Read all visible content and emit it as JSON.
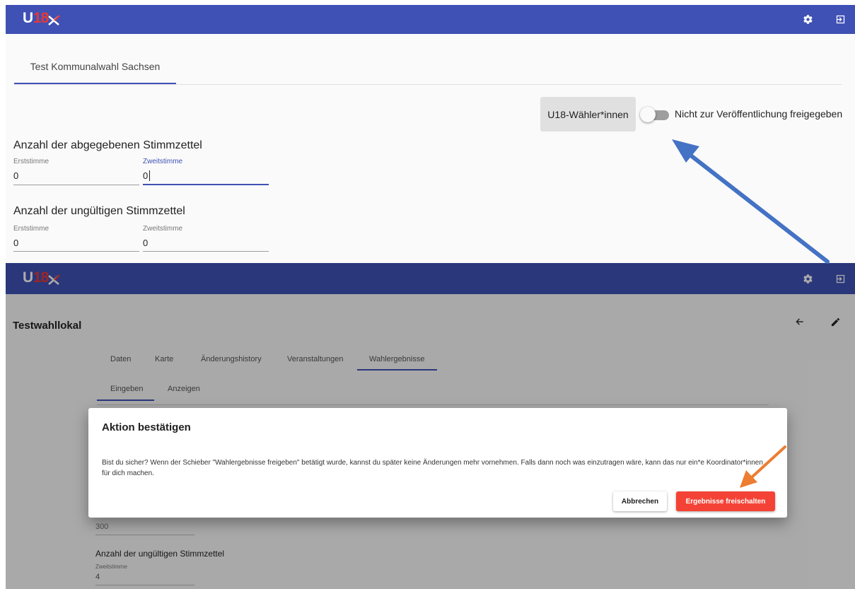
{
  "top_screen": {
    "appbar": {
      "logo_u": "U",
      "logo_num": "18",
      "color": "#3f51b5"
    },
    "tab": {
      "label": "Test Kommunalwahl Sachsen"
    },
    "chip": {
      "label": "U18-Wähler*innen"
    },
    "toggle": {
      "label": "Nicht zur Veröffentlichung freigegeben",
      "on": false
    },
    "section_abgegeben": {
      "title": "Anzahl der abgegebenen Stimmzettel",
      "erststimme": {
        "label": "Erststimme",
        "value": "0"
      },
      "zweitstimme": {
        "label": "Zweitstimme",
        "value": "0"
      }
    },
    "section_ungueltig": {
      "title": "Anzahl der ungültigen Stimmzettel",
      "erststimme": {
        "label": "Erststimme",
        "value": "0"
      },
      "zweitstimme": {
        "label": "Zweitstimme",
        "value": "0"
      }
    }
  },
  "bottom_screen": {
    "appbar": {
      "logo_u": "U",
      "logo_num": "18"
    },
    "page_title": "Testwahllokal",
    "tabs": [
      "Daten",
      "Karte",
      "Änderungshistory",
      "Veranstaltungen",
      "Wahlergebnisse"
    ],
    "subtabs": [
      "Eingeben",
      "Anzeigen"
    ],
    "behind": {
      "value_300": "300",
      "section_title": "Anzahl der ungültigen Stimmzettel",
      "zweitstimme_label": "Zweitstimme",
      "zweitstimme_value": "4"
    },
    "dialog": {
      "title": "Aktion bestätigen",
      "text": "Bist du sicher? Wenn der Schieber \"Wahlergebnisse freigeben\" betätigt wurde, kannst du später keine Änderungen mehr vornehmen. Falls dann noch was einzutragen wäre, kann das nur ein*e Koordinator*innen für dich machen.",
      "cancel_label": "Abbrechen",
      "confirm_label": "Ergebnisse freischalten"
    }
  },
  "colors": {
    "primary": "#3f51b5",
    "accent_red": "#f44336",
    "arrow_blue": "#4472c4",
    "arrow_orange": "#ed7d31"
  }
}
